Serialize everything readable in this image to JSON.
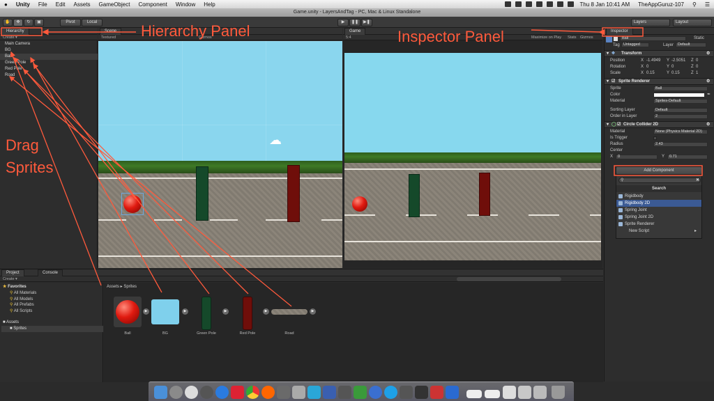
{
  "menubar": {
    "apple": "",
    "items": [
      "Unity",
      "File",
      "Edit",
      "Assets",
      "GameObject",
      "Component",
      "Window",
      "Help"
    ],
    "clock": "Thu 8 Jan  10:41 AM",
    "user": "TheAppGuruz-107"
  },
  "window_title": "Game.unity - LayersAndTag - PC, Mac & Linux Standalone",
  "toolbar": {
    "pivot": "Pivot",
    "local": "Local",
    "layers": "Layers",
    "layout": "Layout"
  },
  "hierarchy": {
    "tab": "Hierarchy",
    "create": "Create",
    "items": [
      "Main Camera",
      "BG",
      "Ball",
      "Green Pole",
      "Red Pole",
      "Road"
    ]
  },
  "scene": {
    "tab": "Scene",
    "mode": "Textured",
    "gizmos": "Gizmos"
  },
  "game": {
    "tab": "Game",
    "aspect": "5:4",
    "maximize": "Maximize on Play",
    "stats": "Stats",
    "gizmos": "Gizmos"
  },
  "inspector": {
    "tab": "Inspector",
    "object_name": "Ball",
    "static": "Static",
    "tag_label": "Tag",
    "tag_value": "Untagged",
    "layer_label": "Layer",
    "layer_value": "Default",
    "transform": {
      "title": "Transform",
      "position": {
        "label": "Position",
        "x": "-1.4949",
        "y": "-2.5051",
        "z": "0"
      },
      "rotation": {
        "label": "Rotation",
        "x": "0",
        "y": "0",
        "z": "0"
      },
      "scale": {
        "label": "Scale",
        "x": "0.15",
        "y": "0.15",
        "z": "1"
      }
    },
    "sprite_renderer": {
      "title": "Sprite Renderer",
      "sprite_label": "Sprite",
      "sprite_value": "Ball",
      "color_label": "Color",
      "material_label": "Material",
      "material_value": "Sprites-Default",
      "sorting_label": "Sorting Layer",
      "sorting_value": "Default",
      "order_label": "Order in Layer",
      "order_value": "2"
    },
    "circle_collider": {
      "title": "Circle Collider 2D",
      "material_label": "Material",
      "material_value": "None (Physics Material 2D)",
      "trigger_label": "Is Trigger",
      "radius_label": "Radius",
      "radius_value": "2.43",
      "center_label": "Center",
      "center_x": "0",
      "center_y": "0.71"
    },
    "add_component": "Add Component",
    "search_header": "Search",
    "components": [
      "Rigidbody",
      "Rigidbody 2D",
      "Spring Joint",
      "Spring Joint 2D",
      "Sprite Renderer",
      "New Script"
    ]
  },
  "project": {
    "tab": "Project",
    "console_tab": "Console",
    "create": "Create",
    "favorites": "Favorites",
    "favorite_items": [
      "All Materials",
      "All Models",
      "All Prefabs",
      "All Scripts"
    ],
    "assets": "Assets",
    "sprites": "Sprites",
    "breadcrumb": [
      "Assets",
      "Sprites"
    ],
    "asset_items": [
      "Ball",
      "BG",
      "Green Pole",
      "Red Pole",
      "Road"
    ]
  },
  "annotations": {
    "hierarchy": "Hierarchy Panel",
    "inspector": "Inspector Panel",
    "drag": [
      "Drag",
      "Sprites"
    ]
  },
  "colors": {
    "annotation": "#ff5a3c",
    "sky": "#87d8ee",
    "green_pole": "#15492a",
    "red_pole": "#6f0e0a",
    "ball": "#e01a10",
    "selection": "#3b5a94"
  }
}
